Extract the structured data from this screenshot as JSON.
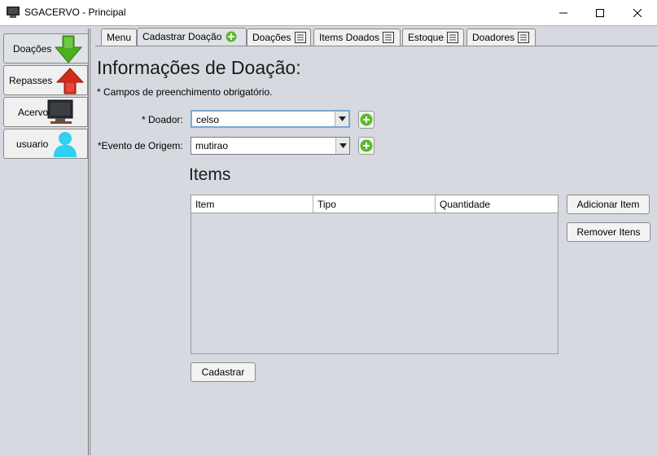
{
  "window": {
    "title": "SGACERVO - Principal"
  },
  "side_tabs": [
    {
      "label": "Doações",
      "icon": "green-down-arrow-icon",
      "selected": true
    },
    {
      "label": "Repasses",
      "icon": "red-up-arrow-icon",
      "selected": false
    },
    {
      "label": "Acervo",
      "icon": "computer-icon",
      "selected": false
    },
    {
      "label": "usuario",
      "icon": "user-icon",
      "selected": false
    }
  ],
  "top_tabs": [
    {
      "label": "Menu",
      "icon": null,
      "selected": false
    },
    {
      "label": "Cadastrar Doação",
      "icon": "add-circle-icon",
      "selected": true
    },
    {
      "label": "Doações",
      "icon": "list-icon",
      "selected": false
    },
    {
      "label": "Items Doados",
      "icon": "list-icon",
      "selected": false
    },
    {
      "label": "Estoque",
      "icon": "list-icon",
      "selected": false
    },
    {
      "label": "Doadores",
      "icon": "list-icon",
      "selected": false
    }
  ],
  "form": {
    "heading": "Informações de Doação:",
    "required_note": "* Campos de preenchimento obrigatório.",
    "doador_label": "* Doador:",
    "doador_value": "celso",
    "evento_label": "*Evento de Origem:",
    "evento_value": "mutirao"
  },
  "items": {
    "title": "Items",
    "columns": [
      "Item",
      "Tipo",
      "Quantidade"
    ],
    "rows": [],
    "add_button": "Adicionar Item",
    "remove_button": "Remover Itens"
  },
  "submit_button": "Cadastrar",
  "colors": {
    "background": "#d6d9df",
    "add_green": "#5cb82a",
    "arrow_green": "#4caf1f",
    "arrow_red": "#d42a1e",
    "user_cyan": "#2fd0f2"
  }
}
